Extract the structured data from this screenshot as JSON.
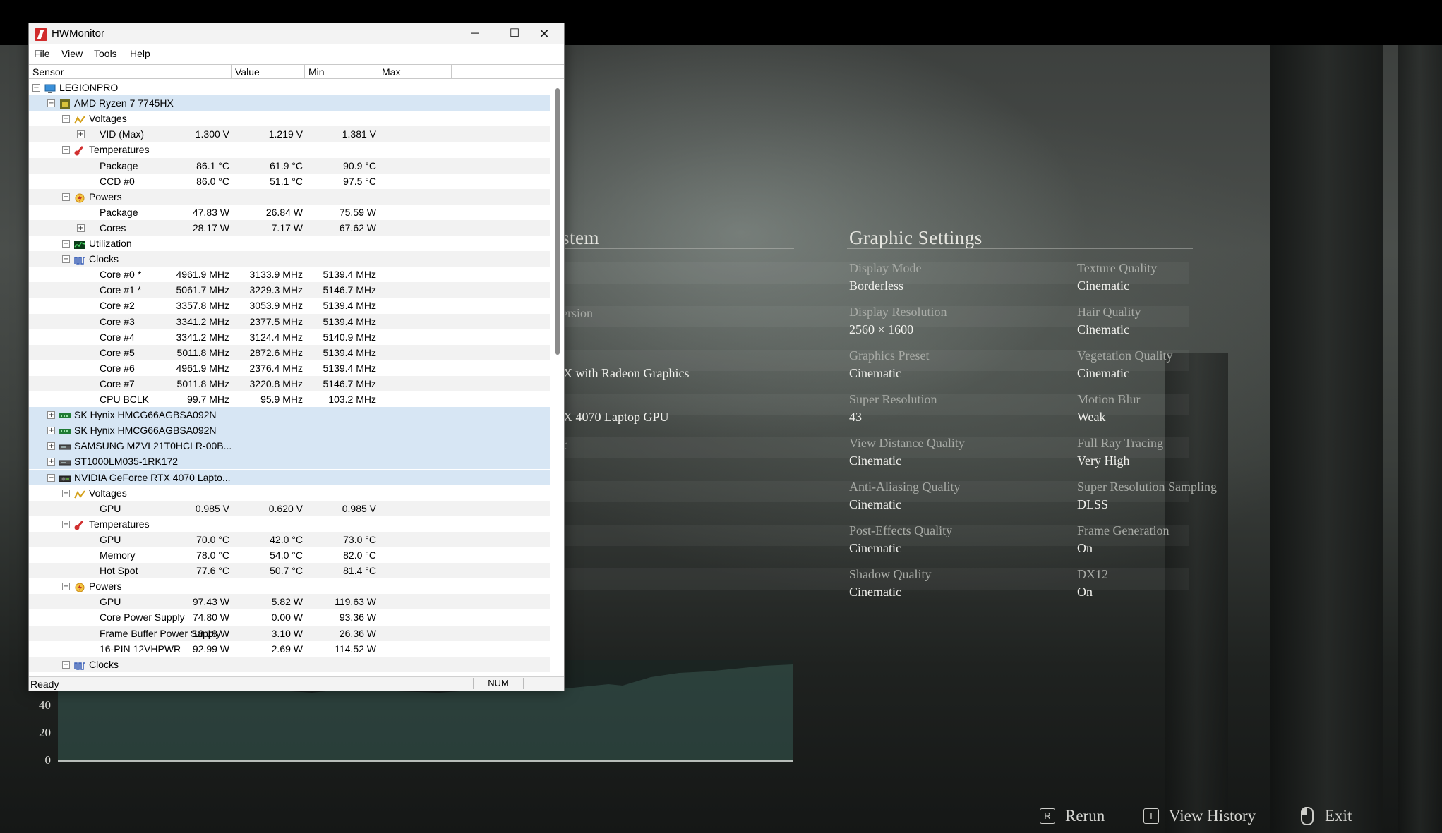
{
  "hwmonitor": {
    "title": "HWMonitor",
    "menu": [
      "File",
      "View",
      "Tools",
      "Help"
    ],
    "columns": [
      "Sensor",
      "Value",
      "Min",
      "Max"
    ],
    "status": "Ready",
    "num_indicator": "NUM",
    "rows": [
      {
        "d": 0,
        "ex": "-",
        "icon": "computer-icon",
        "label": "LEGIONPRO"
      },
      {
        "d": 1,
        "ex": "-",
        "icon": "cpu-icon",
        "label": "AMD Ryzen 7 7745HX",
        "hl": true
      },
      {
        "d": 2,
        "ex": "-",
        "icon": "voltage-icon",
        "label": "Voltages"
      },
      {
        "d": 3,
        "ex": "+",
        "label": "VID (Max)",
        "v": "1.300 V",
        "mn": "1.219 V",
        "mx": "1.381 V"
      },
      {
        "d": 2,
        "ex": "-",
        "icon": "thermometer-icon",
        "label": "Temperatures"
      },
      {
        "d": 3,
        "label": "Package",
        "v": "86.1 °C",
        "mn": "61.9 °C",
        "mx": "90.9 °C"
      },
      {
        "d": 3,
        "label": "CCD #0",
        "v": "86.0 °C",
        "mn": "51.1 °C",
        "mx": "97.5 °C"
      },
      {
        "d": 2,
        "ex": "-",
        "icon": "power-icon",
        "label": "Powers"
      },
      {
        "d": 3,
        "label": "Package",
        "v": "47.83 W",
        "mn": "26.84 W",
        "mx": "75.59 W"
      },
      {
        "d": 3,
        "ex": "+",
        "label": "Cores",
        "v": "28.17 W",
        "mn": "7.17 W",
        "mx": "67.62 W"
      },
      {
        "d": 2,
        "ex": "+",
        "icon": "utilization-icon",
        "label": "Utilization"
      },
      {
        "d": 2,
        "ex": "-",
        "icon": "clock-icon",
        "label": "Clocks"
      },
      {
        "d": 3,
        "label": "Core #0 *",
        "v": "4961.9 MHz",
        "mn": "3133.9 MHz",
        "mx": "5139.4 MHz"
      },
      {
        "d": 3,
        "label": "Core #1 *",
        "v": "5061.7 MHz",
        "mn": "3229.3 MHz",
        "mx": "5146.7 MHz"
      },
      {
        "d": 3,
        "label": "Core #2",
        "v": "3357.8 MHz",
        "mn": "3053.9 MHz",
        "mx": "5139.4 MHz"
      },
      {
        "d": 3,
        "label": "Core #3",
        "v": "3341.2 MHz",
        "mn": "2377.5 MHz",
        "mx": "5139.4 MHz"
      },
      {
        "d": 3,
        "label": "Core #4",
        "v": "3341.2 MHz",
        "mn": "3124.4 MHz",
        "mx": "5140.9 MHz"
      },
      {
        "d": 3,
        "label": "Core #5",
        "v": "5011.8 MHz",
        "mn": "2872.6 MHz",
        "mx": "5139.4 MHz"
      },
      {
        "d": 3,
        "label": "Core #6",
        "v": "4961.9 MHz",
        "mn": "2376.4 MHz",
        "mx": "5139.4 MHz"
      },
      {
        "d": 3,
        "label": "Core #7",
        "v": "5011.8 MHz",
        "mn": "3220.8 MHz",
        "mx": "5146.7 MHz"
      },
      {
        "d": 3,
        "label": "CPU BCLK",
        "v": "99.7 MHz",
        "mn": "95.9 MHz",
        "mx": "103.2 MHz"
      },
      {
        "d": 1,
        "ex": "+",
        "icon": "memory-icon",
        "label": "SK Hynix HMCG66AGBSA092N",
        "hl": true
      },
      {
        "d": 1,
        "ex": "+",
        "icon": "memory-icon",
        "label": "SK Hynix HMCG66AGBSA092N",
        "hl": true
      },
      {
        "d": 1,
        "ex": "+",
        "icon": "disk-icon",
        "label": "SAMSUNG MZVL21T0HCLR-00B...",
        "hl": true
      },
      {
        "d": 1,
        "ex": "+",
        "icon": "disk-icon",
        "label": "ST1000LM035-1RK172",
        "hl": true
      },
      {
        "d": 1,
        "ex": "-",
        "icon": "gpu-icon",
        "label": "NVIDIA GeForce RTX 4070 Lapto...",
        "hl": true
      },
      {
        "d": 2,
        "ex": "-",
        "icon": "voltage-icon",
        "label": "Voltages"
      },
      {
        "d": 3,
        "label": "GPU",
        "v": "0.985 V",
        "mn": "0.620 V",
        "mx": "0.985 V"
      },
      {
        "d": 2,
        "ex": "-",
        "icon": "thermometer-icon",
        "label": "Temperatures"
      },
      {
        "d": 3,
        "label": "GPU",
        "v": "70.0 °C",
        "mn": "42.0 °C",
        "mx": "73.0 °C"
      },
      {
        "d": 3,
        "label": "Memory",
        "v": "78.0 °C",
        "mn": "54.0 °C",
        "mx": "82.0 °C"
      },
      {
        "d": 3,
        "label": "Hot Spot",
        "v": "77.6 °C",
        "mn": "50.7 °C",
        "mx": "81.4 °C"
      },
      {
        "d": 2,
        "ex": "-",
        "icon": "power-icon",
        "label": "Powers"
      },
      {
        "d": 3,
        "label": "GPU",
        "v": "97.43 W",
        "mn": "5.82 W",
        "mx": "119.63 W"
      },
      {
        "d": 3,
        "label": "Core Power Supply",
        "v": "74.80 W",
        "mn": "0.00 W",
        "mx": "93.36 W"
      },
      {
        "d": 3,
        "label": "Frame Buffer Power Supply",
        "v": "18.18 W",
        "mn": "3.10 W",
        "mx": "26.36 W"
      },
      {
        "d": 3,
        "label": "16-PIN 12VHPWR",
        "v": "92.99 W",
        "mn": "2.69 W",
        "mx": "114.52 W"
      },
      {
        "d": 2,
        "ex": "-",
        "icon": "clock-icon",
        "label": "Clocks"
      }
    ]
  },
  "benchmark": {
    "system_title_partial": "stem",
    "system_partials": [
      {
        "text": "ersion",
        "dim": true
      },
      {
        "text": "t",
        "dim": false
      },
      {
        "text": "X with Radeon Graphics",
        "dim": false
      },
      {
        "text": "X 4070 Laptop GPU",
        "dim": false
      },
      {
        "text": "r",
        "dim": true
      }
    ],
    "graphic_settings_title": "Graphic Settings",
    "settings_left": [
      {
        "label": "Display Mode",
        "value": "Borderless"
      },
      {
        "label": "Display Resolution",
        "value": "2560 × 1600"
      },
      {
        "label": "Graphics Preset",
        "value": "Cinematic"
      },
      {
        "label": "Super Resolution",
        "value": "43"
      },
      {
        "label": "View Distance Quality",
        "value": "Cinematic"
      },
      {
        "label": "Anti-Aliasing Quality",
        "value": "Cinematic"
      },
      {
        "label": "Post-Effects Quality",
        "value": "Cinematic"
      },
      {
        "label": "Shadow Quality",
        "value": "Cinematic"
      }
    ],
    "settings_right": [
      {
        "label": "Texture Quality",
        "value": "Cinematic"
      },
      {
        "label": "Hair Quality",
        "value": "Cinematic"
      },
      {
        "label": "Vegetation Quality",
        "value": "Cinematic"
      },
      {
        "label": "Motion Blur",
        "value": "Weak"
      },
      {
        "label": "Full Ray Tracing",
        "value": "Very High"
      },
      {
        "label": "Super Resolution Sampling",
        "value": "DLSS"
      },
      {
        "label": "Frame Generation",
        "value": "On"
      },
      {
        "label": "DX12",
        "value": "On"
      }
    ],
    "graph_ticks": [
      "40",
      "20",
      "0"
    ],
    "hints": [
      {
        "key": "R",
        "label": "Rerun"
      },
      {
        "key": "T",
        "label": "View History"
      },
      {
        "key": "mouse",
        "label": "Exit"
      }
    ]
  }
}
